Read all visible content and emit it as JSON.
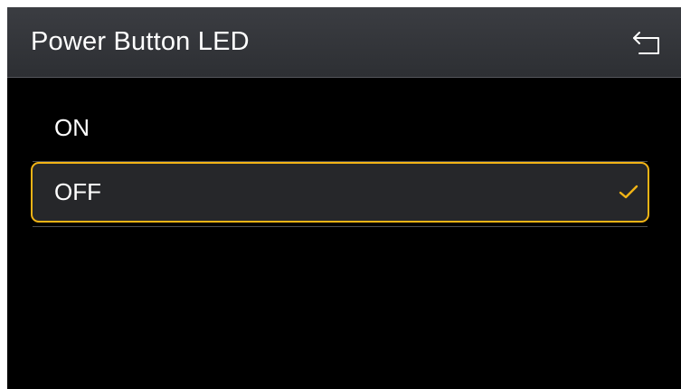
{
  "header": {
    "title": "Power Button LED",
    "back_icon": "back-arrow-icon"
  },
  "options": [
    {
      "label": "ON",
      "selected": false
    },
    {
      "label": "OFF",
      "selected": true
    }
  ],
  "selected_check_icon": "checkmark-icon",
  "colors": {
    "background": "#000000",
    "header": "#35373b",
    "accent": "#f2b416",
    "text": "#ffffff",
    "divider": "#4a4c50"
  }
}
